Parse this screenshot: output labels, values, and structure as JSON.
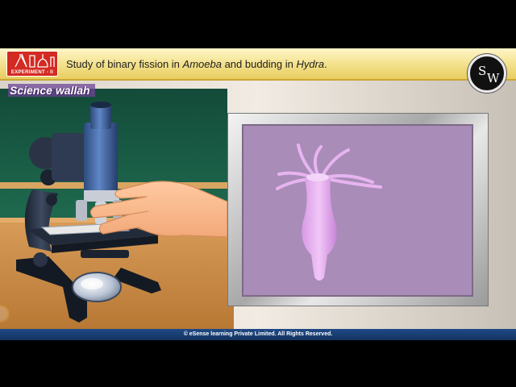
{
  "header": {
    "badge_label": "EXPERIMENT - II",
    "title_prefix": "Study of binary fission in ",
    "title_em1": "Amoeba",
    "title_mid": " and budding in ",
    "title_em2": "Hydra",
    "title_suffix": "."
  },
  "logo": {
    "letter1": "S",
    "letter2": "W"
  },
  "watermark": {
    "text": "Science wallah"
  },
  "footer": {
    "copyright": "© eSense learning Private Limited. All Rights Reserved."
  },
  "colors": {
    "title_bar": "#f3e08a",
    "badge": "#d32a22",
    "board": "#1f6b4f",
    "wall": "#e6ddd1",
    "table": "#c98c48",
    "slide_view": "#a98cb8",
    "hydra": "#e7b4f0",
    "footer": "#1f4a86"
  }
}
